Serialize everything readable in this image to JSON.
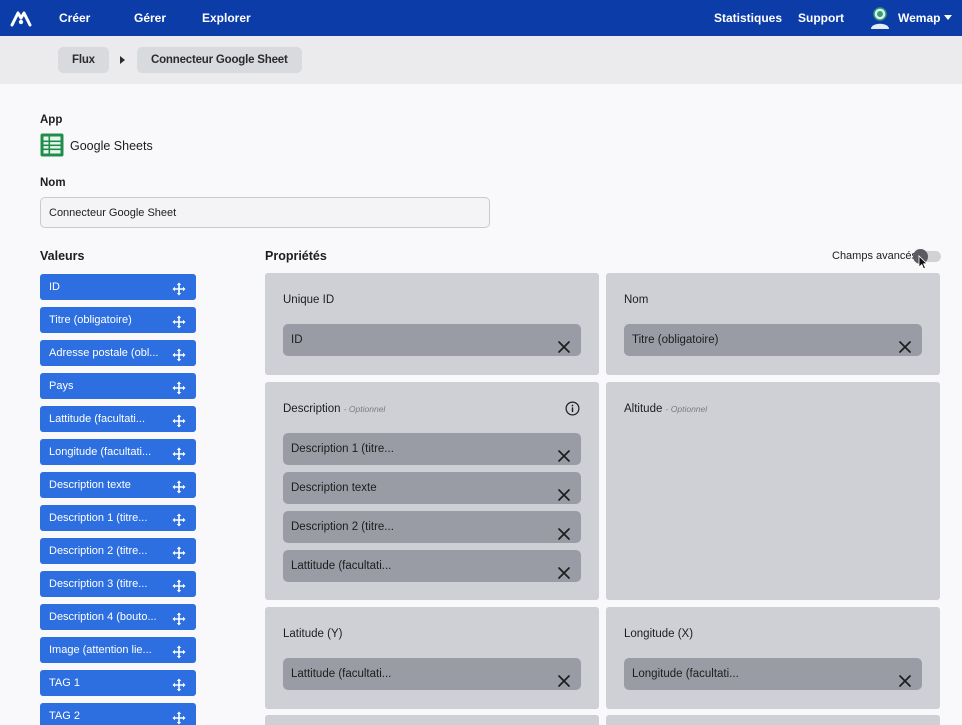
{
  "topnav": {
    "items": [
      "Créer",
      "Gérer",
      "Explorer"
    ],
    "right_items": [
      "Statistiques",
      "Support"
    ],
    "user": "Wemap"
  },
  "breadcrumb": [
    "Flux",
    "Connecteur Google Sheet"
  ],
  "app": {
    "label": "App",
    "name": "Google Sheets",
    "icon": "google-sheets-icon"
  },
  "name_field": {
    "label": "Nom",
    "value": "Connecteur Google Sheet"
  },
  "values": {
    "title": "Valeurs",
    "items": [
      "ID",
      "Titre (obligatoire)",
      "Adresse postale (obl...",
      "Pays",
      "Lattitude (facultati...",
      "Longitude (facultati...",
      "Description texte",
      "Description 1 (titre...",
      "Description 2 (titre...",
      "Description 3 (titre...",
      "Description 4 (bouto...",
      "Image (attention lie...",
      "TAG 1",
      "TAG 2"
    ]
  },
  "properties": {
    "title": "Propriétés",
    "advanced_toggle_label": "Champs avancés",
    "advanced_enabled": false,
    "optional_label": "- Optionnel",
    "cards": [
      {
        "title": "Unique ID",
        "optional": false,
        "items": [
          "ID"
        ]
      },
      {
        "title": "Nom",
        "optional": false,
        "items": [
          "Titre (obligatoire)"
        ]
      },
      {
        "title": "Description",
        "optional": true,
        "info": true,
        "items": [
          "Description 1 (titre...",
          "Description texte",
          "Description 2 (titre...",
          "Lattitude (facultati..."
        ]
      },
      {
        "title": "Altitude",
        "optional": true,
        "items": []
      },
      {
        "title": "Latitude (Y)",
        "optional": false,
        "items": [
          "Lattitude (facultati..."
        ]
      },
      {
        "title": "Longitude (X)",
        "optional": false,
        "items": [
          "Longitude (facultati..."
        ]
      }
    ]
  },
  "colors": {
    "topbar": "#0b3ca8",
    "value_chip": "#2d6fe0",
    "card": "#cfd0d5",
    "drop_item": "#9a9ca5"
  }
}
